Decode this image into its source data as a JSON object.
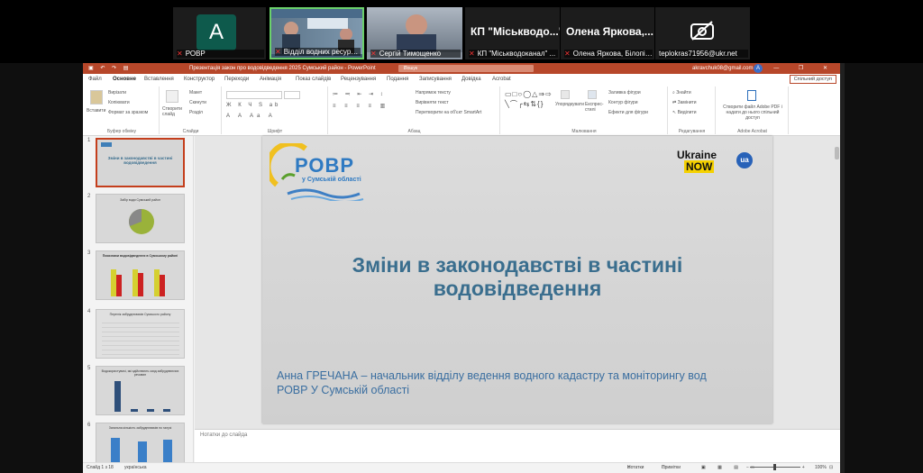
{
  "meeting": {
    "tiles": [
      {
        "name": "РОВР",
        "avatar_letter": "A"
      },
      {
        "name": "Відділ водних ресурсів Р...",
        "video_text": "ДВРЕ in the Sumy region РОВР"
      },
      {
        "name": "Сергій Тимощенко"
      },
      {
        "name": "КП \"Міськводоканал\" ...",
        "big_text": "КП \"Міськводо...\""
      },
      {
        "name": "Олена Яркова, Білопіл...",
        "big_text": "Олена Яркова,..."
      },
      {
        "name": "teplokras71956@ukr.net"
      }
    ]
  },
  "ppt": {
    "window_title": "Презентація закон про водовідведення 2025 Сумський район  -  PowerPoint",
    "search_placeholder": "Пошук",
    "account": "akravchuk08@gmail.com",
    "account_initial": "A",
    "window_controls": "— ❐ ✕",
    "tabs": [
      "Файл",
      "Основне",
      "Вставлення",
      "Конструктор",
      "Переходи",
      "Анімація",
      "Показ слайдів",
      "Рецензування",
      "Подання",
      "Записування",
      "Довідка",
      "Acrobat"
    ],
    "active_tab": "Основне",
    "share_label": "Спільний доступ",
    "ribbon_groups": {
      "clipboard": {
        "label": "Буфер обміну",
        "paste": "Вставити",
        "cut": "Вирізати",
        "copy": "Копіювати",
        "format": "Формат за зразком"
      },
      "slides": {
        "label": "Слайди",
        "new_slide": "Створити слайд",
        "layout": "Макет",
        "reset": "Скинути",
        "section": "Розділ"
      },
      "font": {
        "label": "Шрифт"
      },
      "paragraph": {
        "label": "Абзац",
        "text_direction": "Напрямок тексту",
        "align_text": "Вирівняти текст",
        "smartart": "Перетворити на об'єкт SmartArt"
      },
      "drawing": {
        "label": "Малювання",
        "arrange": "Упорядкувати",
        "quick_styles": "Експрес-стилі",
        "fill": "Заливка фігури",
        "outline": "Контур фігури",
        "effects": "Ефекти для фігури"
      },
      "editing": {
        "label": "Редагування",
        "find": "Знайти",
        "replace": "Замінити",
        "select": "Виділити"
      },
      "acrobat": {
        "label": "Adobe Acrobat",
        "create_pdf": "Створити файл Adobe PDF і надати до нього спільний доступ"
      }
    },
    "thumbnails": [
      {
        "num": "1",
        "title": "Зміни в законодавстві в частині водовідведення"
      },
      {
        "num": "2",
        "title": "Забір води Сумський район"
      },
      {
        "num": "3",
        "title": "Показники водовідведення в Сумському районі"
      },
      {
        "num": "4",
        "title": "Перелік забруднювачів Сумського району"
      },
      {
        "num": "5",
        "title": "Водокористувачі, які здійснюють скид забруднюючих речовин"
      },
      {
        "num": "6",
        "title": "Загальна кількість забруднювачів по галузі"
      }
    ],
    "slide": {
      "logo_text": "РОВР",
      "logo_subtext": "у Сумській області",
      "badge_main": "Ukraine",
      "badge_now": "NOW",
      "badge_ua": "ua",
      "title": "Зміни в законодавстві в частині водовідведення",
      "subtitle_line1": "Анна ГРЕЧАНА – начальник відділу ведення водного кадастру та моніторингу вод",
      "subtitle_line2": "РОВР У Сумській області"
    },
    "notes_placeholder": "Нотатки до слайда",
    "status": {
      "slide_counter": "Слайд 1 з 18",
      "language": "українська",
      "notes": "Нотатки",
      "comments": "Примітки",
      "zoom": "100%"
    },
    "colors": {
      "accent": "#b7472a",
      "title": "#3a6e8e",
      "subtitle": "#3a6ea0"
    }
  }
}
